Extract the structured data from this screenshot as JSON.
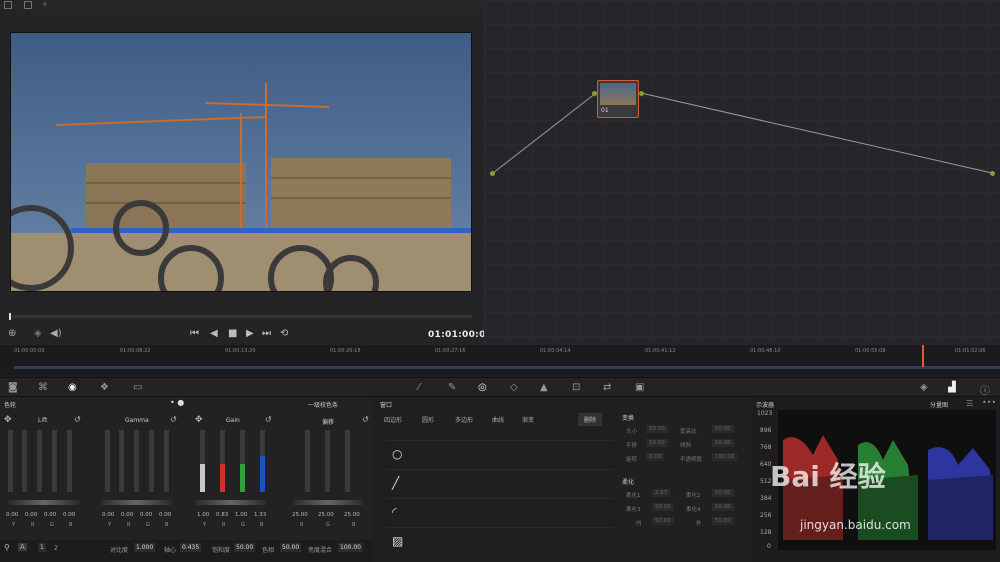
{
  "viewer": {
    "timecode": "01:01:00:00"
  },
  "node": {
    "label": "01"
  },
  "timeline": {
    "ticks": [
      "01:00:00:00",
      "01:00:08:22",
      "01:00:13:20",
      "01:00:20:18",
      "01:00:27:16",
      "01:00:34:14",
      "01:00:41:12",
      "01:00:48:10",
      "01:00:55:08",
      "01:01:02:06"
    ]
  },
  "wheels": {
    "title": "色轮",
    "mode": "一级校色条",
    "items": [
      {
        "name": "Lift",
        "vals": [
          "0.00",
          "0.00",
          "0.00",
          "0.00"
        ]
      },
      {
        "name": "Gamma",
        "vals": [
          "0.00",
          "0.00",
          "0.00",
          "0.00"
        ]
      },
      {
        "name": "Gain",
        "vals": [
          "1.00",
          "0.83",
          "1.00",
          "1.33"
        ]
      },
      {
        "name": "偏移",
        "vals": [
          "25.00",
          "25.00",
          "25.00"
        ]
      }
    ],
    "channels": [
      "Y",
      "R",
      "G",
      "B"
    ],
    "bottom": {
      "tab1": "1",
      "tab2": "2",
      "contrast_label": "对比度",
      "contrast": "1.000",
      "pivot_label": "轴心",
      "pivot": "0.435",
      "sat_label": "饱和度",
      "sat": "50.00",
      "hue_label": "色相",
      "hue": "50.00",
      "lummix_label": "亮度混合",
      "lummix": "100.00"
    }
  },
  "window": {
    "title": "窗口",
    "tools": [
      "四边形",
      "圆形",
      "多边形",
      "曲线",
      "渐变"
    ],
    "delete": "删除"
  },
  "transform": {
    "title": "变换",
    "rows": [
      [
        "大小",
        "50.00",
        "宽高比",
        "50.00"
      ],
      [
        "平移",
        "50.00",
        "倾斜",
        "50.00"
      ],
      [
        "旋转",
        "0.00",
        "不透明度",
        "100.00"
      ]
    ],
    "soft_title": "柔化",
    "soft": [
      [
        "柔化1",
        "2.67",
        "柔化2",
        "50.00"
      ],
      [
        "柔化3",
        "50.00",
        "柔化4",
        "50.00"
      ],
      [
        "内",
        "50.00",
        "外",
        "50.00"
      ]
    ]
  },
  "scopes": {
    "title": "示波器",
    "mode": "分量图",
    "labels": [
      "1023",
      "896",
      "768",
      "640",
      "512",
      "384",
      "256",
      "128",
      "0"
    ]
  },
  "watermark": {
    "brand": "Bai 经验",
    "url": "jingyan.baidu.com"
  }
}
